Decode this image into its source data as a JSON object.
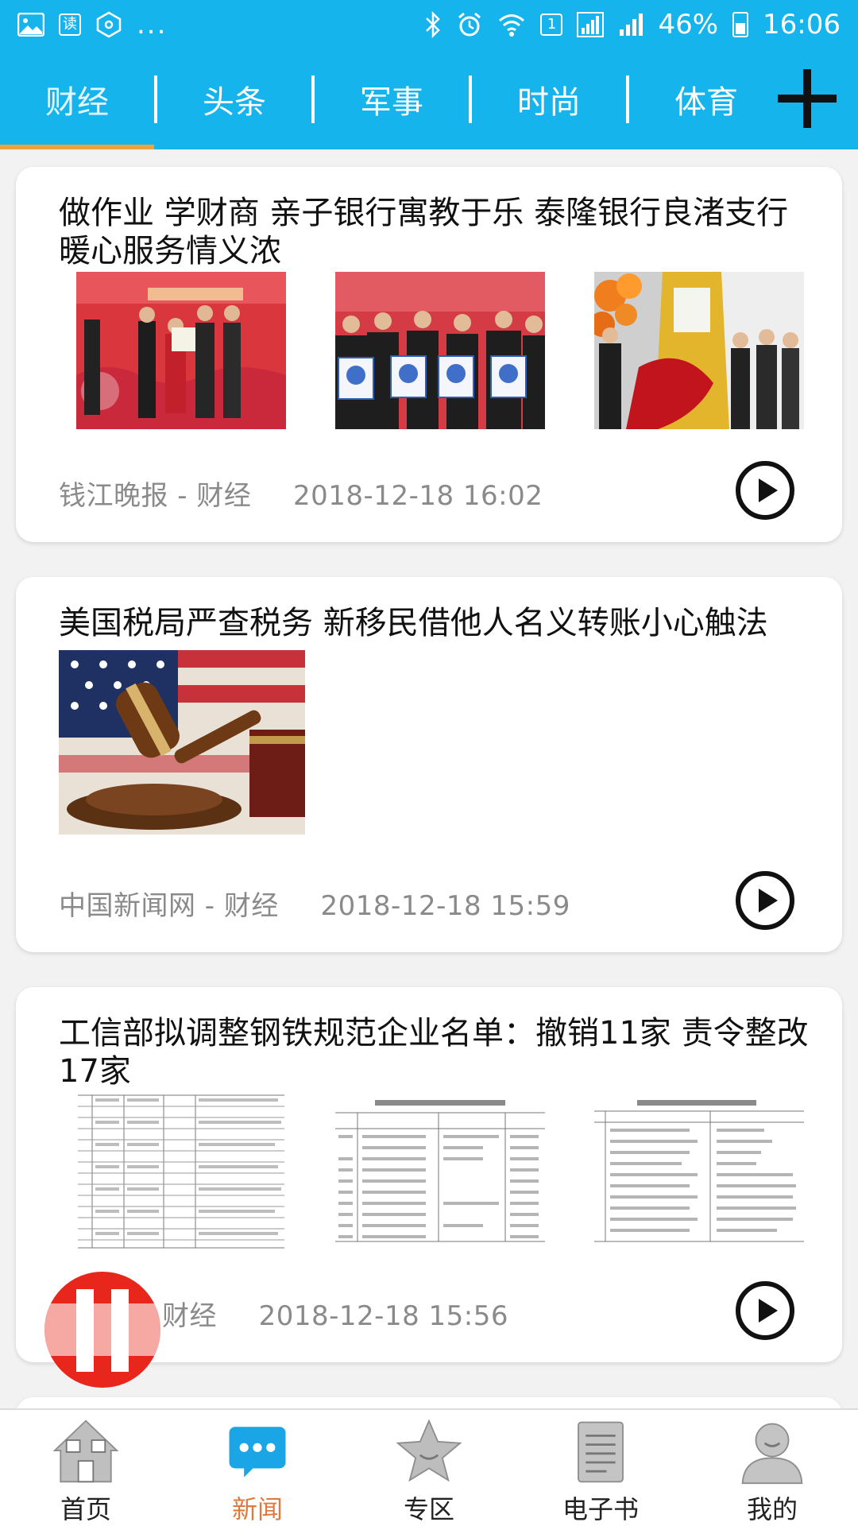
{
  "status_bar": {
    "left_icons": [
      "image-icon",
      "read-app-icon",
      "hexagon-app-icon"
    ],
    "read_badge": "读",
    "more": "...",
    "right_icons": [
      "bluetooth-icon",
      "alarm-icon",
      "wifi-icon",
      "sim1-icon",
      "signal-icon",
      "signal-icon-2",
      "battery-icon"
    ],
    "sim": "1",
    "battery": "46%",
    "time": "16:06"
  },
  "tabs": {
    "items": [
      {
        "label": "财经",
        "active": true
      },
      {
        "label": "头条"
      },
      {
        "label": "军事"
      },
      {
        "label": "时尚"
      },
      {
        "label": "体育"
      }
    ],
    "add_icon": "plus-icon",
    "accent": "#16b4ec",
    "active_indicator": "#f2a23a"
  },
  "feed": {
    "articles": [
      {
        "title": "做作业 学财商 亲子银行寓教于乐 泰隆银行良渚支行暖心服务情义浓",
        "images": [
          "ceremony-photo",
          "group-photo",
          "opening-ribbon-photo"
        ],
        "source": "钱江晚报 - 财经",
        "time": "2018-12-18 16:02"
      },
      {
        "title": "美国税局严查税务 新移民借他人名义转账小心触法",
        "images": [
          "gavel-flag-photo"
        ],
        "source": "中国新闻网 - 财经",
        "time": "2018-12-18 15:59"
      },
      {
        "title": "工信部拟调整钢铁规范企业名单：撤销11家 责令整改17家",
        "images": [
          "document-table-1",
          "document-table-2",
          "document-table-3"
        ],
        "source": "财经",
        "time": "2018-12-18 15:56"
      }
    ],
    "play_icon": "play-circle-icon"
  },
  "floating_button": {
    "icon": "pause-icon",
    "color": "#e8261b"
  },
  "bottom_nav": {
    "items": [
      {
        "label": "首页",
        "icon": "home-icon"
      },
      {
        "label": "新闻",
        "icon": "news-chat-icon",
        "active": true
      },
      {
        "label": "专区",
        "icon": "star-icon"
      },
      {
        "label": "电子书",
        "icon": "ebook-icon"
      },
      {
        "label": "我的",
        "icon": "user-icon"
      }
    ],
    "active_color": "#e07a3c"
  }
}
